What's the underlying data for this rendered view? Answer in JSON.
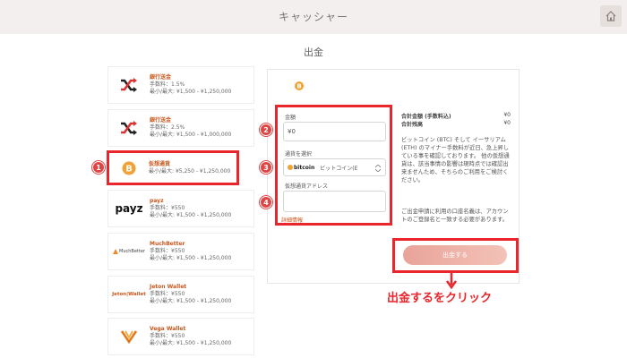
{
  "header": {
    "title": "キャッシャー"
  },
  "page": {
    "title": "出金"
  },
  "methods": [
    {
      "name": "銀行送金",
      "fee": "手数料：1.5%",
      "limits": "最小/最大: ¥1,500 - ¥1,250,000"
    },
    {
      "name": "銀行送金",
      "fee": "手数料：2.5%",
      "limits": "最小/最大: ¥1,500 - ¥1,000,000"
    },
    {
      "name": "仮想通貨",
      "fee": "",
      "limits": "最小/最大: ¥5,250 - ¥1,250,000"
    },
    {
      "name": "payz",
      "fee": "手数料：¥550",
      "limits": "最小/最大: ¥1,500 - ¥1,250,000",
      "logo": "payz"
    },
    {
      "name": "MuchBetter",
      "fee": "手数料：¥550",
      "limits": "最小/最大: ¥1,500 - ¥1,250,000",
      "logo": "MuchBetter"
    },
    {
      "name": "Jeton Wallet",
      "fee": "手数料：¥550",
      "limits": "最小/最大: ¥1,500 - ¥1,250,000",
      "logo": "Jeton|Wallet"
    },
    {
      "name": "Vega Wallet",
      "fee": "手数料：¥550",
      "limits": "最小/最大: ¥1,500 - ¥1,250,000"
    }
  ],
  "form": {
    "amount_label": "金額",
    "amount_value": "¥0",
    "currency_label": "通貨を選択",
    "currency_logo": "bitcoin",
    "currency_value": "ビットコイン(E",
    "address_label": "仮想通貨アドレス",
    "address_value": "",
    "details_link": "詳細情報"
  },
  "summary": {
    "total_label": "合計金額 (手数料込)",
    "total_value": "¥0",
    "balance_label": "合計残高",
    "balance_value": "¥0",
    "desc1": "ビットコイン (BTC) そして イーサリアム (ETH) のマイナー手数料が近日、急上昇している事を確認しております。 他の仮想通貨は、該当事情の影響は現時点では確認出来ませんため、そちらのご利用をご検討ください。",
    "desc2": "ご出金申請に利用の口座名義は、アカウントのご登録名と一致する必要があります。"
  },
  "submit": {
    "label": "出金する"
  },
  "annotations": {
    "badges": [
      "1",
      "2",
      "3",
      "4"
    ],
    "click_text": "出金するをクリック"
  },
  "colors": {
    "accent_red": "#e8262c",
    "method_name": "#c8571d",
    "bitcoin_orange": "#f2a134"
  }
}
